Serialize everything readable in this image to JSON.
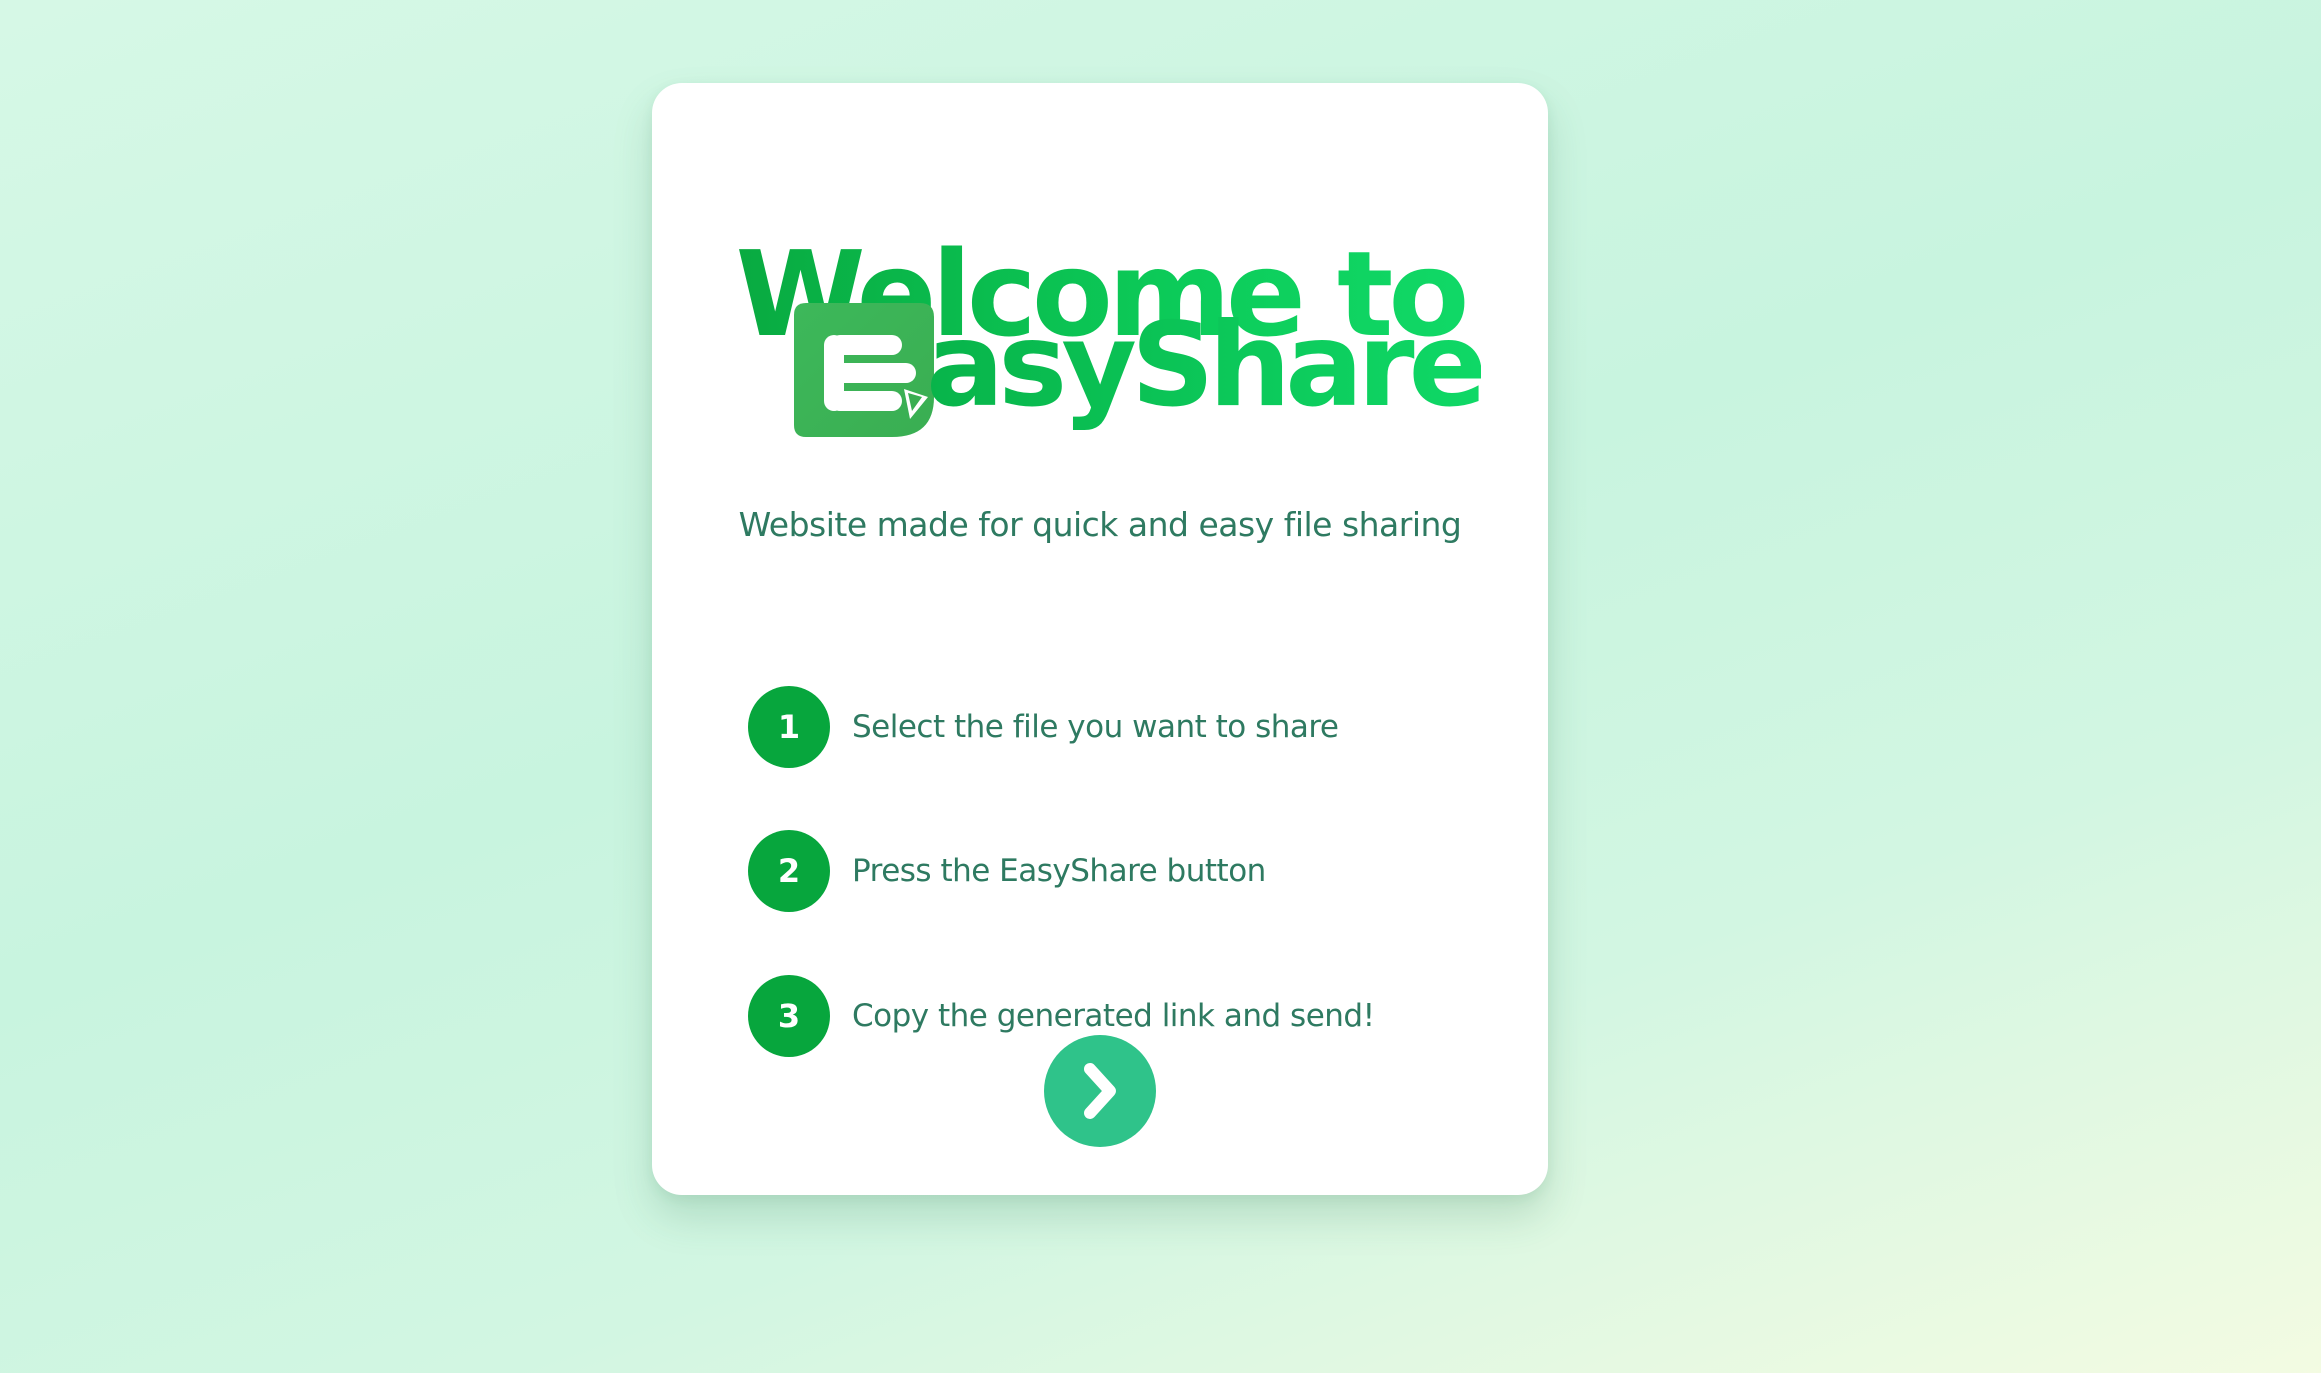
{
  "card": {
    "title_line1": "Welcome to",
    "brand_name": "asyShare",
    "subtitle": "Website made for quick and easy file sharing"
  },
  "steps": [
    {
      "number": "1",
      "text": "Select the file you want to share"
    },
    {
      "number": "2",
      "text": "Press the EasyShare button"
    },
    {
      "number": "3",
      "text": "Copy the generated link and send!"
    }
  ],
  "icons": {
    "logo": "easyshare-logo-icon",
    "next": "chevron-right-icon"
  },
  "colors": {
    "brand_green": "#0aba45",
    "step_badge": "#07a63d",
    "text": "#2e7a61",
    "button": "#2fc38a"
  }
}
